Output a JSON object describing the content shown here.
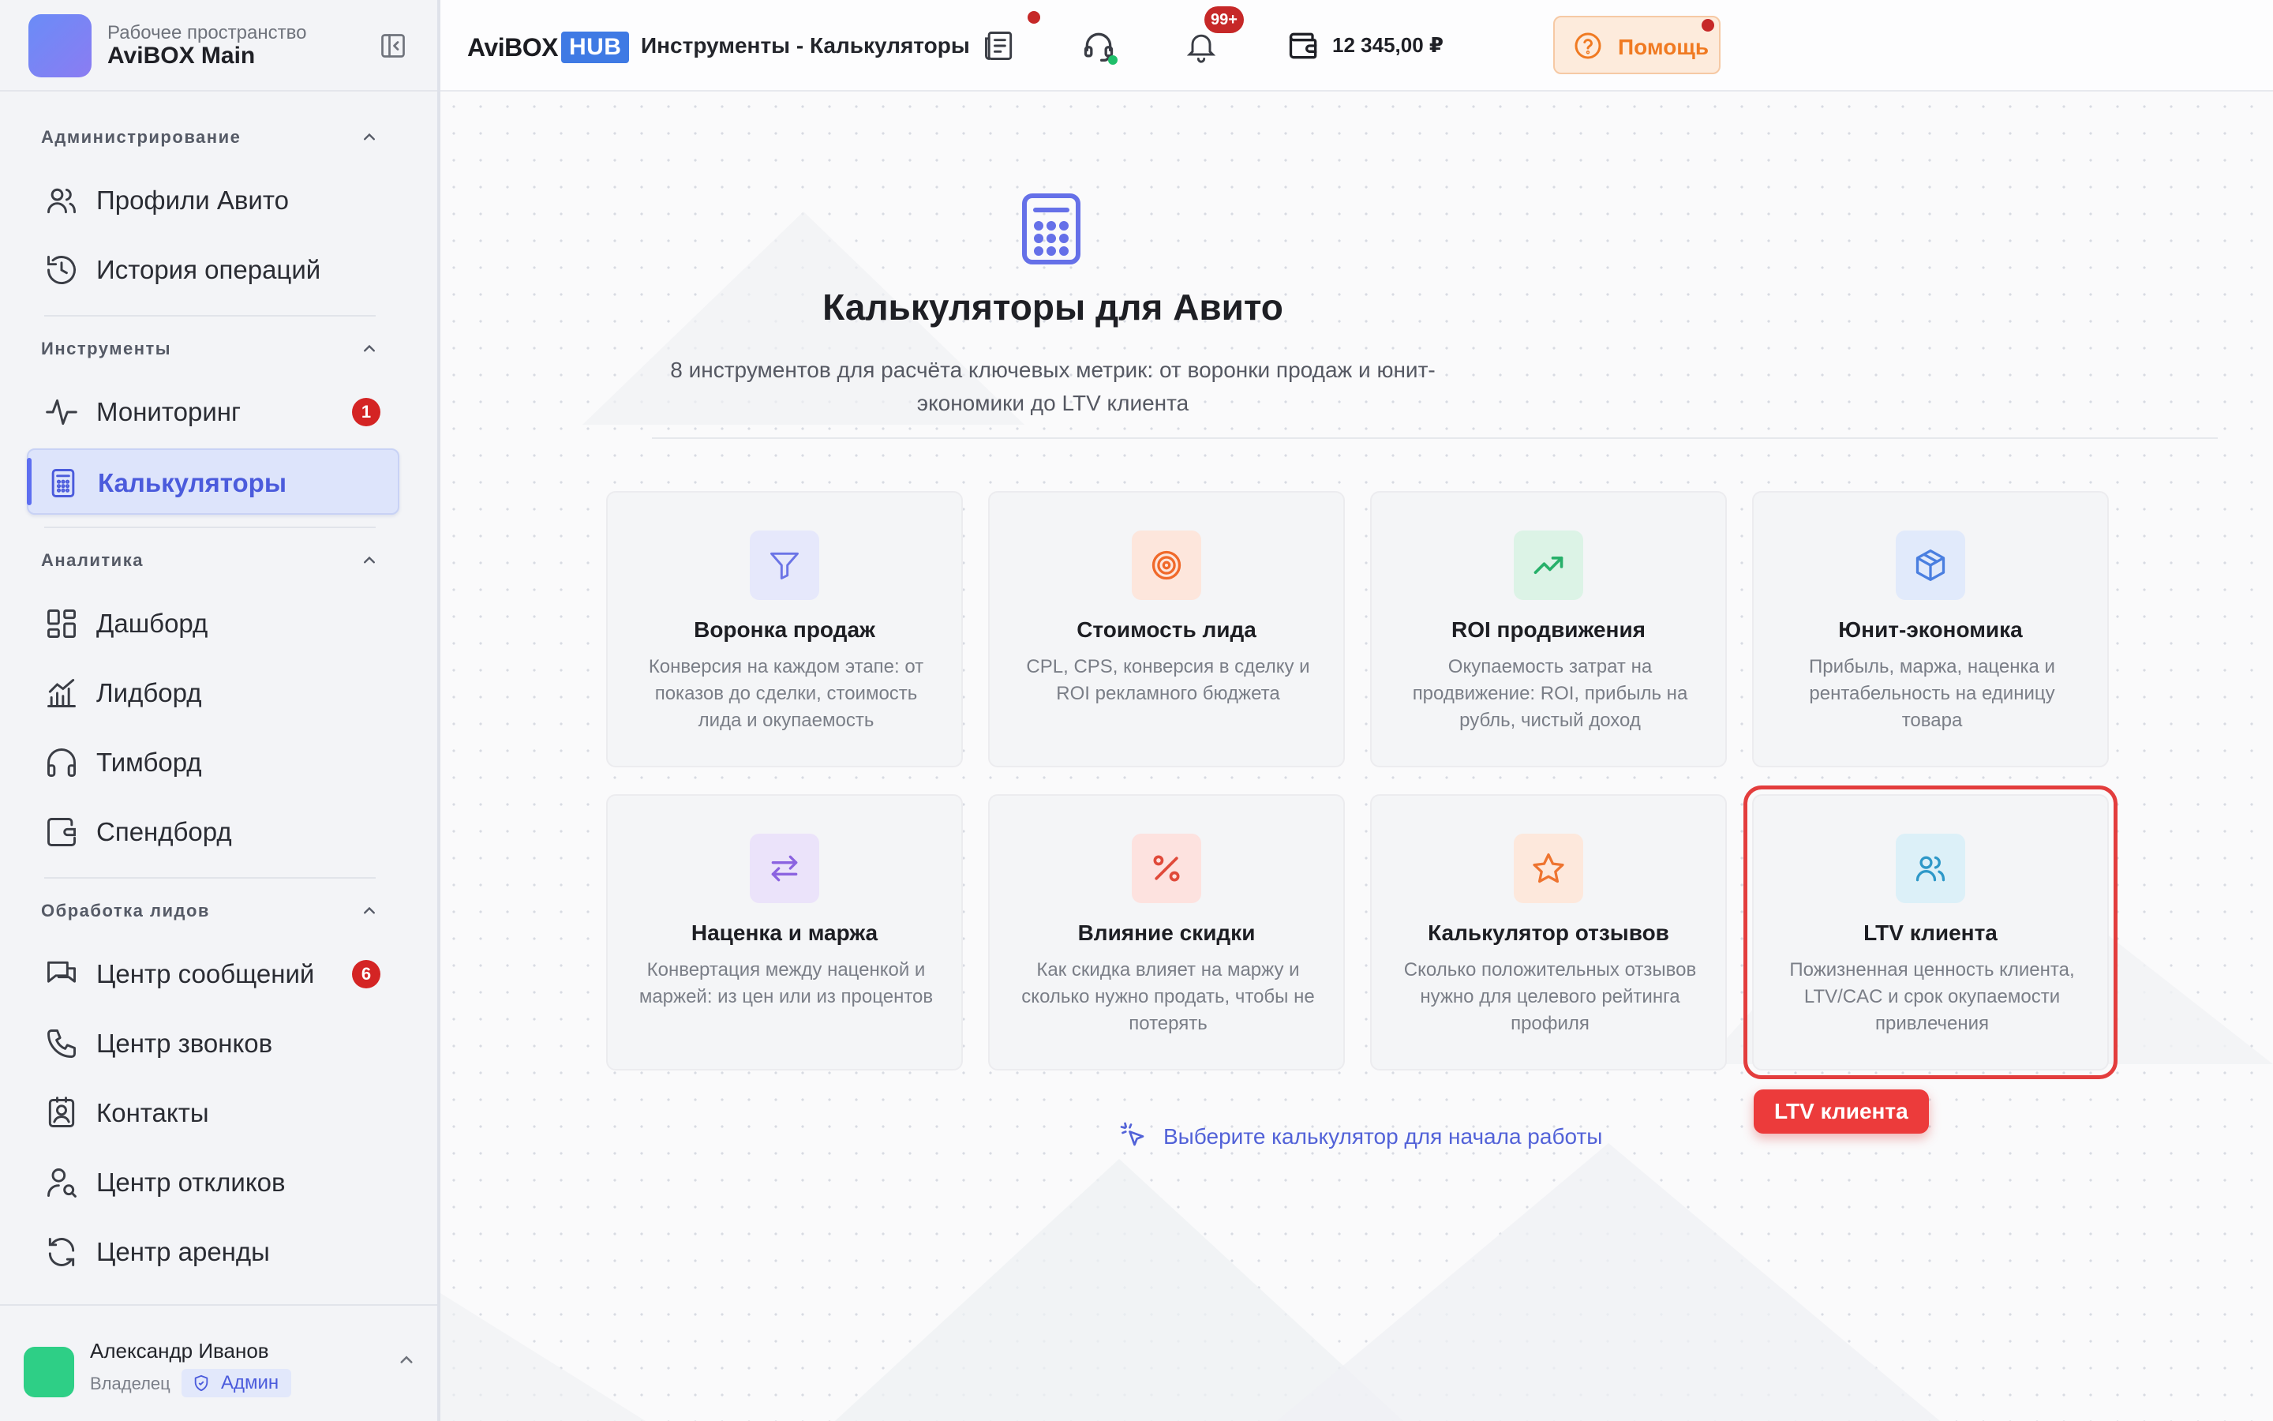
{
  "workspace": {
    "caption": "Рабочее пространство",
    "name": "AviBOX Main"
  },
  "sidebar": {
    "sections": [
      {
        "title": "Администрирование",
        "items": [
          {
            "label": "Профили Авито",
            "icon": "users-icon"
          },
          {
            "label": "История операций",
            "icon": "history-icon"
          }
        ]
      },
      {
        "title": "Инструменты",
        "items": [
          {
            "label": "Мониторинг",
            "icon": "pulse-icon",
            "badge": "1"
          },
          {
            "label": "Калькуляторы",
            "icon": "calculator-icon",
            "active": true
          }
        ]
      },
      {
        "title": "Аналитика",
        "items": [
          {
            "label": "Дашборд",
            "icon": "dashboard-icon"
          },
          {
            "label": "Лидборд",
            "icon": "chart-icon"
          },
          {
            "label": "Тимборд",
            "icon": "headphones-icon"
          },
          {
            "label": "Спендборд",
            "icon": "wallet-icon"
          }
        ]
      },
      {
        "title": "Обработка лидов",
        "items": [
          {
            "label": "Центр сообщений",
            "icon": "messages-icon",
            "badge": "6"
          },
          {
            "label": "Центр звонков",
            "icon": "phone-icon"
          },
          {
            "label": "Контакты",
            "icon": "contacts-icon"
          },
          {
            "label": "Центр откликов",
            "icon": "user-search-icon"
          },
          {
            "label": "Центр аренды",
            "icon": "refresh-icon"
          }
        ]
      }
    ]
  },
  "user": {
    "name": "Александр Иванов",
    "role": "Владелец",
    "tag": "Админ"
  },
  "header": {
    "brand_a": "AviBOX",
    "brand_b": "HUB",
    "breadcrumb": "Инструменты - Калькуляторы",
    "help_label": "Помощь",
    "notifications_badge": "99+",
    "balance": "12 345,00 ₽"
  },
  "main": {
    "title": "Калькуляторы для Авито",
    "subtitle": "8 инструментов для расчёта ключевых метрик: от воронки продаж и юнит-экономики до LTV клиента",
    "hint": "Выберите калькулятор для начала работы",
    "tooltip": "LTV клиента",
    "cards": [
      {
        "title": "Воронка продаж",
        "desc": "Конверсия на каждом этапе: от показов до сделки, стоимость лида и окупаемость",
        "icon": "filter-icon",
        "bg": "#e6e8fb",
        "color": "#6b74e6"
      },
      {
        "title": "Стоимость лида",
        "desc": "CPL, CPS, конверсия в сделку и ROI рекламного бюджета",
        "icon": "target-icon",
        "bg": "#fde6dc",
        "color": "#f0692a"
      },
      {
        "title": "ROI продвижения",
        "desc": "Окупаемость затрат на продвижение: ROI, прибыль на рубль, чистый доход",
        "icon": "trending-up-icon",
        "bg": "#dcf3e6",
        "color": "#27b06a"
      },
      {
        "title": "Юнит-экономика",
        "desc": "Прибыль, маржа, наценка и рентабельность на единицу товара",
        "icon": "box-icon",
        "bg": "#e1eafb",
        "color": "#4a7fe0"
      },
      {
        "title": "Наценка и маржа",
        "desc": "Конвертация между наценкой и маржей: из цен или из процентов",
        "icon": "arrows-icon",
        "bg": "#ebe3fa",
        "color": "#8b63e0"
      },
      {
        "title": "Влияние скидки",
        "desc": "Как скидка влияет на маржу и сколько нужно продать, чтобы не потерять",
        "icon": "percent-icon",
        "bg": "#fde2df",
        "color": "#e04a3a"
      },
      {
        "title": "Калькулятор отзывов",
        "desc": "Сколько положительных отзывов нужно для целевого рейтинга профиля",
        "icon": "star-icon",
        "bg": "#fde8dc",
        "color": "#ee7430"
      },
      {
        "title": "LTV клиента",
        "desc": "Пожизненная ценность клиента, LTV/CAC и срок окупаемости привлечения",
        "icon": "users-icon",
        "bg": "#dcf0f8",
        "color": "#2e98c8",
        "selected": true
      }
    ]
  }
}
